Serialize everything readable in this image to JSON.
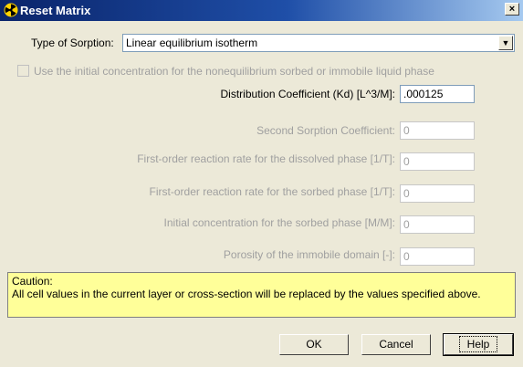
{
  "window": {
    "title": "Reset Matrix",
    "close_glyph": "×"
  },
  "sorption": {
    "label": "Type of Sorption:",
    "selected": "Linear equilibrium isotherm",
    "dropdown_glyph": "▼"
  },
  "initial_conc_checkbox": {
    "label": "Use the initial concentration for the nonequilibrium sorbed or immobile liquid phase",
    "checked": false
  },
  "fields": {
    "kd": {
      "label": "Distribution Coefficient (Kd) [L^3/M]:",
      "value": ".000125"
    },
    "second_sorption": {
      "label": "Second Sorption Coefficient:",
      "value": "0"
    },
    "rate_dissolved": {
      "label": "First-order reaction rate for the dissolved phase [1/T]:",
      "value": "0"
    },
    "rate_sorbed": {
      "label": "First-order reaction rate for the sorbed phase [1/T]:",
      "value": "0"
    },
    "init_conc_sorbed": {
      "label": "Initial concentration for the sorbed phase [M/M]:",
      "value": "0"
    },
    "porosity_immobile": {
      "label": "Porosity of the immobile domain  [-]:",
      "value": "0"
    }
  },
  "caution": {
    "heading": "Caution:",
    "text": "All cell values in the current layer or cross-section will be replaced by the values specified above."
  },
  "buttons": {
    "ok": "OK",
    "cancel": "Cancel",
    "help": "Help"
  },
  "colors": {
    "dialog_bg": "#ece9d8",
    "caution_bg": "#ffff99",
    "title_start": "#0a246a",
    "title_end": "#a6caf0"
  }
}
